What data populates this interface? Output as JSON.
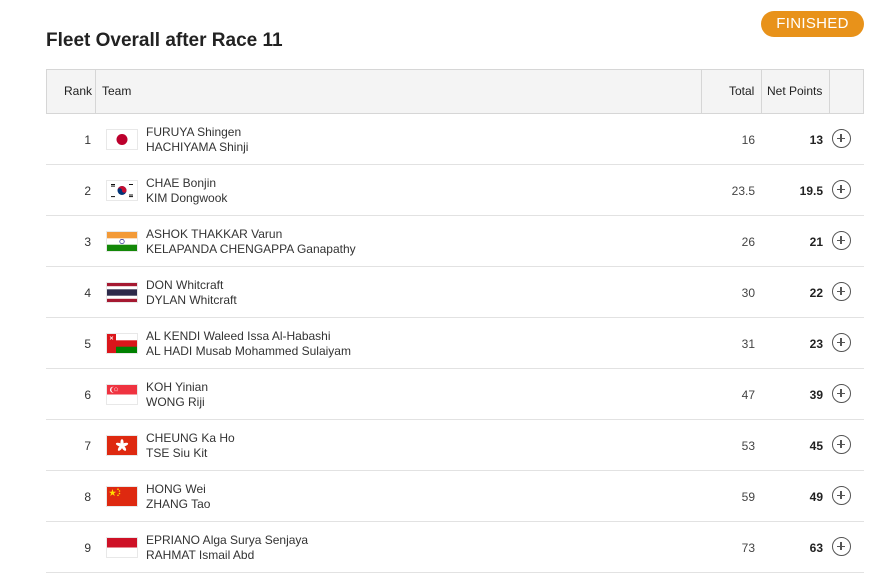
{
  "page": {
    "title": "Fleet Overall after Race 11",
    "status": "FINISHED",
    "status_color": "#e8921a"
  },
  "table": {
    "headers": {
      "rank": "Rank",
      "team": "Team",
      "total": "Total",
      "net": "Net Points"
    },
    "rows": [
      {
        "rank": "1",
        "flag": "JPN",
        "name1": "FURUYA Shingen",
        "name2": "HACHIYAMA Shinji",
        "total": "16",
        "net": "13"
      },
      {
        "rank": "2",
        "flag": "KOR",
        "name1": "CHAE Bonjin",
        "name2": "KIM Dongwook",
        "total": "23.5",
        "net": "19.5"
      },
      {
        "rank": "3",
        "flag": "IND",
        "name1": "ASHOK THAKKAR Varun",
        "name2": "KELAPANDA CHENGAPPA Ganapathy",
        "total": "26",
        "net": "21"
      },
      {
        "rank": "4",
        "flag": "THA",
        "name1": "DON Whitcraft",
        "name2": "DYLAN Whitcraft",
        "total": "30",
        "net": "22"
      },
      {
        "rank": "5",
        "flag": "OMA",
        "name1": "AL KENDI Waleed Issa Al-Habashi",
        "name2": "AL HADI Musab Mohammed Sulaiyam",
        "total": "31",
        "net": "23"
      },
      {
        "rank": "6",
        "flag": "SGP",
        "name1": "KOH Yinian",
        "name2": "WONG Riji",
        "total": "47",
        "net": "39"
      },
      {
        "rank": "7",
        "flag": "HKG",
        "name1": "CHEUNG Ka Ho",
        "name2": "TSE Siu Kit",
        "total": "53",
        "net": "45"
      },
      {
        "rank": "8",
        "flag": "CHN",
        "name1": "HONG Wei",
        "name2": "ZHANG Tao",
        "total": "59",
        "net": "49"
      },
      {
        "rank": "9",
        "flag": "INA",
        "name1": "EPRIANO Alga Surya Senjaya",
        "name2": "RAHMAT Ismail Abd",
        "total": "73",
        "net": "63"
      }
    ]
  }
}
